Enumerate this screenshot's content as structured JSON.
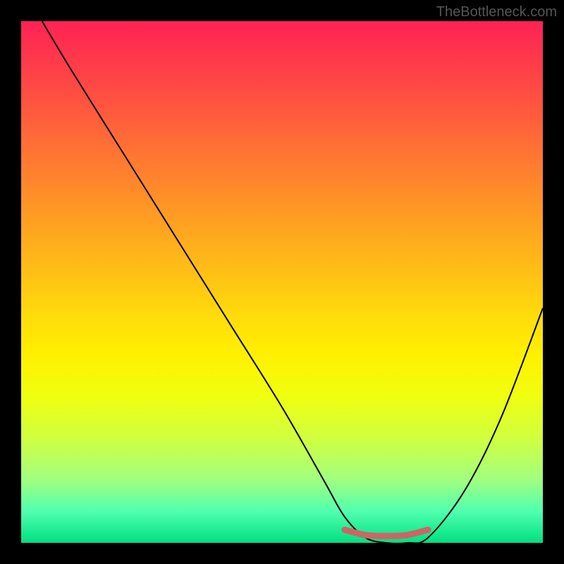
{
  "watermark": "TheBottleneck.com",
  "chart_data": {
    "type": "line",
    "title": "",
    "xlabel": "",
    "ylabel": "",
    "xlim": [
      0,
      100
    ],
    "ylim": [
      0,
      100
    ],
    "series": [
      {
        "name": "curve",
        "x": [
          4,
          10,
          20,
          30,
          40,
          50,
          58,
          62,
          66,
          70,
          74,
          78,
          85,
          92,
          100
        ],
        "y": [
          100,
          90,
          74,
          58,
          42,
          26,
          12,
          5,
          1,
          0,
          0,
          1,
          10,
          24,
          45
        ],
        "color": "#000000"
      },
      {
        "name": "minimum-marker",
        "x": [
          62,
          66,
          70,
          74,
          78
        ],
        "y": [
          2.5,
          1.5,
          1.3,
          1.5,
          2.5
        ],
        "color": "#cc6666"
      }
    ]
  }
}
